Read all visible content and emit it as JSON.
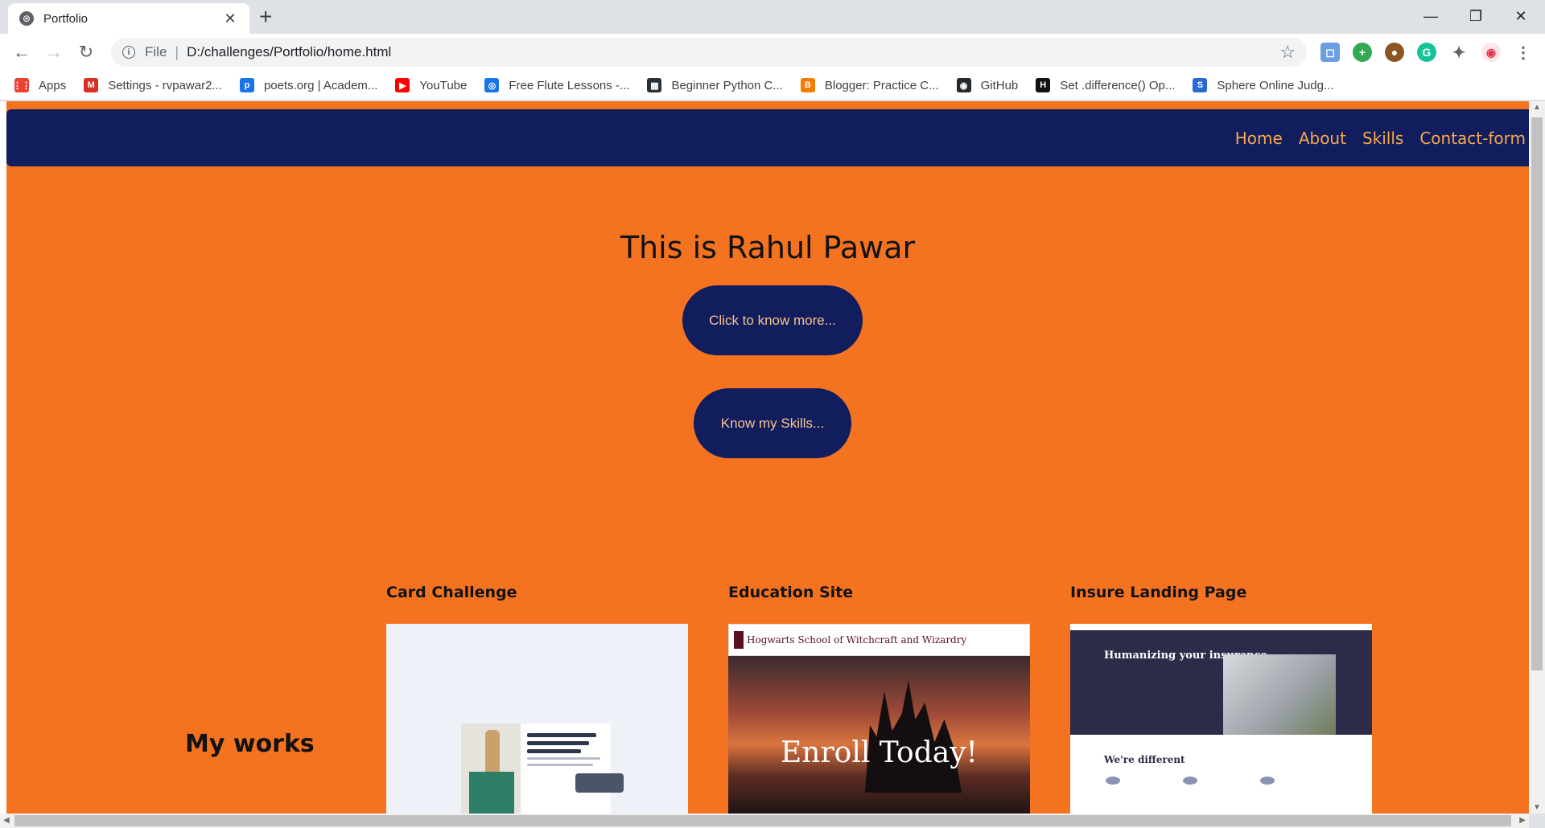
{
  "browser": {
    "tab_title": "Portfolio",
    "new_tab": "+",
    "url_scheme": "File",
    "url": "D:/challenges/Portfolio/home.html",
    "bookmarks": [
      {
        "label": "Apps",
        "icon": "apps-grid-icon",
        "color": "#ea4335"
      },
      {
        "label": "Settings - rvpawar2...",
        "icon": "gmail-icon",
        "color": "#d93025"
      },
      {
        "label": "poets.org | Academ...",
        "icon": "poets-icon",
        "color": "#1a73e8"
      },
      {
        "label": "YouTube",
        "icon": "youtube-icon",
        "color": "#ff0000"
      },
      {
        "label": "Free Flute Lessons -...",
        "icon": "flute-icon",
        "color": "#1a73e8"
      },
      {
        "label": "Beginner Python C...",
        "icon": "python-course-icon",
        "color": "#263238"
      },
      {
        "label": "Blogger: Practice C...",
        "icon": "blogger-icon",
        "color": "#f57c00"
      },
      {
        "label": "GitHub",
        "icon": "github-icon",
        "color": "#24292e"
      },
      {
        "label": "Set .difference() Op...",
        "icon": "hackerrank-icon",
        "color": "#111111"
      },
      {
        "label": "Sphere Online Judg...",
        "icon": "spoj-icon",
        "color": "#2a6bd1"
      }
    ]
  },
  "site": {
    "nav": [
      "Home",
      "About",
      "Skills",
      "Contact-form"
    ],
    "hero_title": "This is Rahul Pawar",
    "btn_know_more": "Click to know more...",
    "btn_skills": "Know my Skills...",
    "works_label": "My works",
    "projects": [
      {
        "title": "Card Challenge"
      },
      {
        "title": "Education Site",
        "thumb_brand": "Hogwarts School of Witchcraft and Wizardry",
        "thumb_text": "Enroll Today!"
      },
      {
        "title": "Insure Landing Page",
        "thumb_heading": "Humanizing your insurance.",
        "thumb_sub": "We're different"
      }
    ]
  },
  "colors": {
    "page_bg": "#f47321",
    "navbar_bg": "#121d5e",
    "nav_link": "#f6a94a",
    "button_bg": "#121d5e",
    "button_text": "#f6c48b"
  }
}
